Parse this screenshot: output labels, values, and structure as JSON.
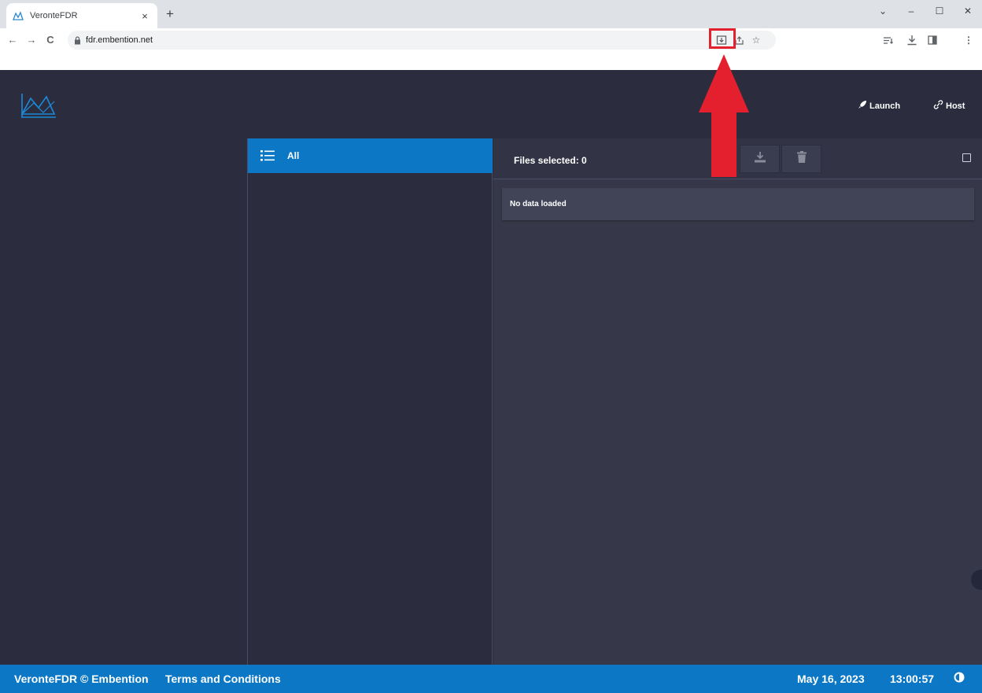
{
  "browser": {
    "tab_title": "VeronteFDR",
    "tab_close": "×",
    "new_tab": "+",
    "url": "fdr.embention.net",
    "window_controls": {
      "minimize": "–",
      "maximize": "☐",
      "close": "✕",
      "tabsearch": "⌄"
    }
  },
  "header": {
    "launch_label": "Launch",
    "host_label": "Host"
  },
  "categories": {
    "items": [
      {
        "label": "All",
        "icon": "list-icon"
      }
    ]
  },
  "files": {
    "selected_text": "Files selected: 0",
    "empty_text": "No data loaded"
  },
  "footer": {
    "brand": "VeronteFDR © Embention",
    "terms": "Terms and Conditions",
    "date": "May 16, 2023",
    "time": "13:00:57"
  },
  "colors": {
    "accent": "#0c78c5",
    "background": "#2b2d3f",
    "panel": "#363849",
    "annotation": "#e5202e"
  }
}
